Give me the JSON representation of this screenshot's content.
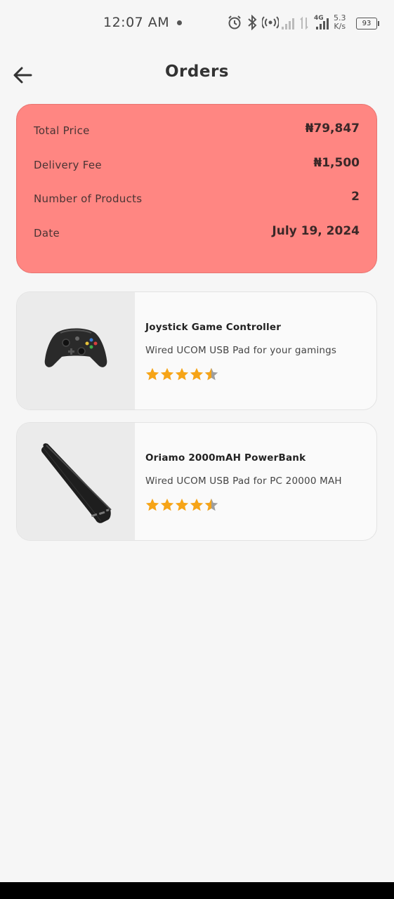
{
  "status_bar": {
    "time": "12:07 AM",
    "network": "4G",
    "speed_value": "5.3",
    "speed_unit": "K/s",
    "battery": "93",
    "icons": [
      "alarm-icon",
      "bluetooth-icon",
      "hotspot-icon",
      "signal-icon",
      "data-arrows-icon",
      "signal-4g-icon",
      "battery-icon"
    ]
  },
  "header": {
    "title": "Orders",
    "back_icon": "arrow-left-icon"
  },
  "summary": {
    "rows": [
      {
        "label": "Total Price",
        "value": "₦79,847"
      },
      {
        "label": "Delivery Fee",
        "value": "₦1,500"
      },
      {
        "label": "Number of Products",
        "value": "2"
      },
      {
        "label": "Date",
        "value": "July 19, 2024"
      }
    ],
    "background_color": "#ff8682"
  },
  "products": [
    {
      "name": "Joystick Game Controller",
      "description": "Wired UCOM USB Pad for your gamings",
      "rating": 4.5,
      "image": "game-controller"
    },
    {
      "name": "Oriamo 2000mAH PowerBank",
      "description": "Wired UCOM USB Pad for PC 20000 MAH",
      "rating": 4.5,
      "image": "power-bank"
    }
  ],
  "colors": {
    "star": "#f6a417",
    "star_empty": "#9e9e9e",
    "background": "#f6f6f6"
  }
}
